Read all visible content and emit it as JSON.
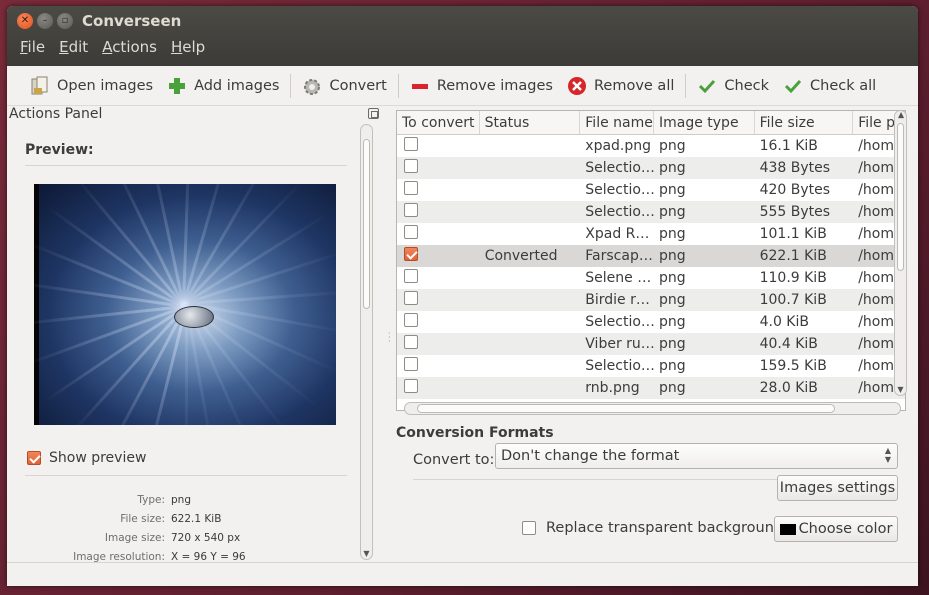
{
  "window": {
    "title": "Converseen",
    "controls": [
      "close",
      "minimize",
      "maximize"
    ]
  },
  "menubar": [
    {
      "label": "File",
      "mnemonic": "F",
      "rest": "ile"
    },
    {
      "label": "Edit",
      "mnemonic": "E",
      "rest": "dit"
    },
    {
      "label": "Actions",
      "mnemonic": "A",
      "rest": "ctions"
    },
    {
      "label": "Help",
      "mnemonic": "H",
      "rest": "elp"
    }
  ],
  "toolbar": {
    "open_images": "Open images",
    "add_images": "Add images",
    "convert": "Convert",
    "remove_images": "Remove images",
    "remove_all": "Remove all",
    "check": "Check",
    "check_all": "Check all"
  },
  "actions_panel": {
    "title": "Actions Panel",
    "preview_label": "Preview:",
    "show_preview_label": "Show preview",
    "show_preview_checked": true,
    "info": {
      "type_label": "Type:",
      "type_value": "png",
      "file_size_label": "File size:",
      "file_size_value": "622.1 KiB",
      "image_size_label": "Image size:",
      "image_size_value": "720 x 540 px",
      "resolution_label": "Image resolution:",
      "resolution_value": "X = 96 Y = 96"
    }
  },
  "table": {
    "columns": [
      "To convert",
      "Status",
      "File name",
      "Image type",
      "File size",
      "File p"
    ],
    "rows": [
      {
        "checked": false,
        "status": "",
        "file_name": "xpad.png",
        "image_type": "png",
        "file_size": "16.1 KiB",
        "file_path": "/hom"
      },
      {
        "checked": false,
        "status": "",
        "file_name": "Selectio…",
        "image_type": "png",
        "file_size": "438 Bytes",
        "file_path": "/hom"
      },
      {
        "checked": false,
        "status": "",
        "file_name": "Selectio…",
        "image_type": "png",
        "file_size": "420 Bytes",
        "file_path": "/hom"
      },
      {
        "checked": false,
        "status": "",
        "file_name": "Selectio…",
        "image_type": "png",
        "file_size": "555 Bytes",
        "file_path": "/hom"
      },
      {
        "checked": false,
        "status": "",
        "file_name": "Xpad R…",
        "image_type": "png",
        "file_size": "101.1 KiB",
        "file_path": "/hom"
      },
      {
        "checked": true,
        "status": "Converted",
        "file_name": "Farscap…",
        "image_type": "png",
        "file_size": "622.1 KiB",
        "file_path": "/hom",
        "selected": true
      },
      {
        "checked": false,
        "status": "",
        "file_name": "Selene …",
        "image_type": "png",
        "file_size": "110.9 KiB",
        "file_path": "/hom"
      },
      {
        "checked": false,
        "status": "",
        "file_name": "Birdie r…",
        "image_type": "png",
        "file_size": "100.7 KiB",
        "file_path": "/hom"
      },
      {
        "checked": false,
        "status": "",
        "file_name": "Selectio…",
        "image_type": "png",
        "file_size": "4.0 KiB",
        "file_path": "/hom"
      },
      {
        "checked": false,
        "status": "",
        "file_name": "Viber ru…",
        "image_type": "png",
        "file_size": "40.4 KiB",
        "file_path": "/hom"
      },
      {
        "checked": false,
        "status": "",
        "file_name": "Selectio…",
        "image_type": "png",
        "file_size": "159.5 KiB",
        "file_path": "/hom"
      },
      {
        "checked": false,
        "status": "",
        "file_name": "rnb.png",
        "image_type": "png",
        "file_size": "28.0 KiB",
        "file_path": "/hom"
      }
    ]
  },
  "conversion": {
    "title": "Conversion Formats",
    "convert_to_label": "Convert to:",
    "format_value": "Don't change the format",
    "images_settings": "Images settings",
    "replace_bg_label": "Replace transparent background",
    "replace_bg_checked": false,
    "choose_color": "Choose color"
  },
  "colors": {
    "accent": "#e06436",
    "titlebar": "#3c3b37",
    "window_bg": "#f2f1f0",
    "check_icon": "#4aa03a",
    "remove_icon": "#d7262b"
  }
}
